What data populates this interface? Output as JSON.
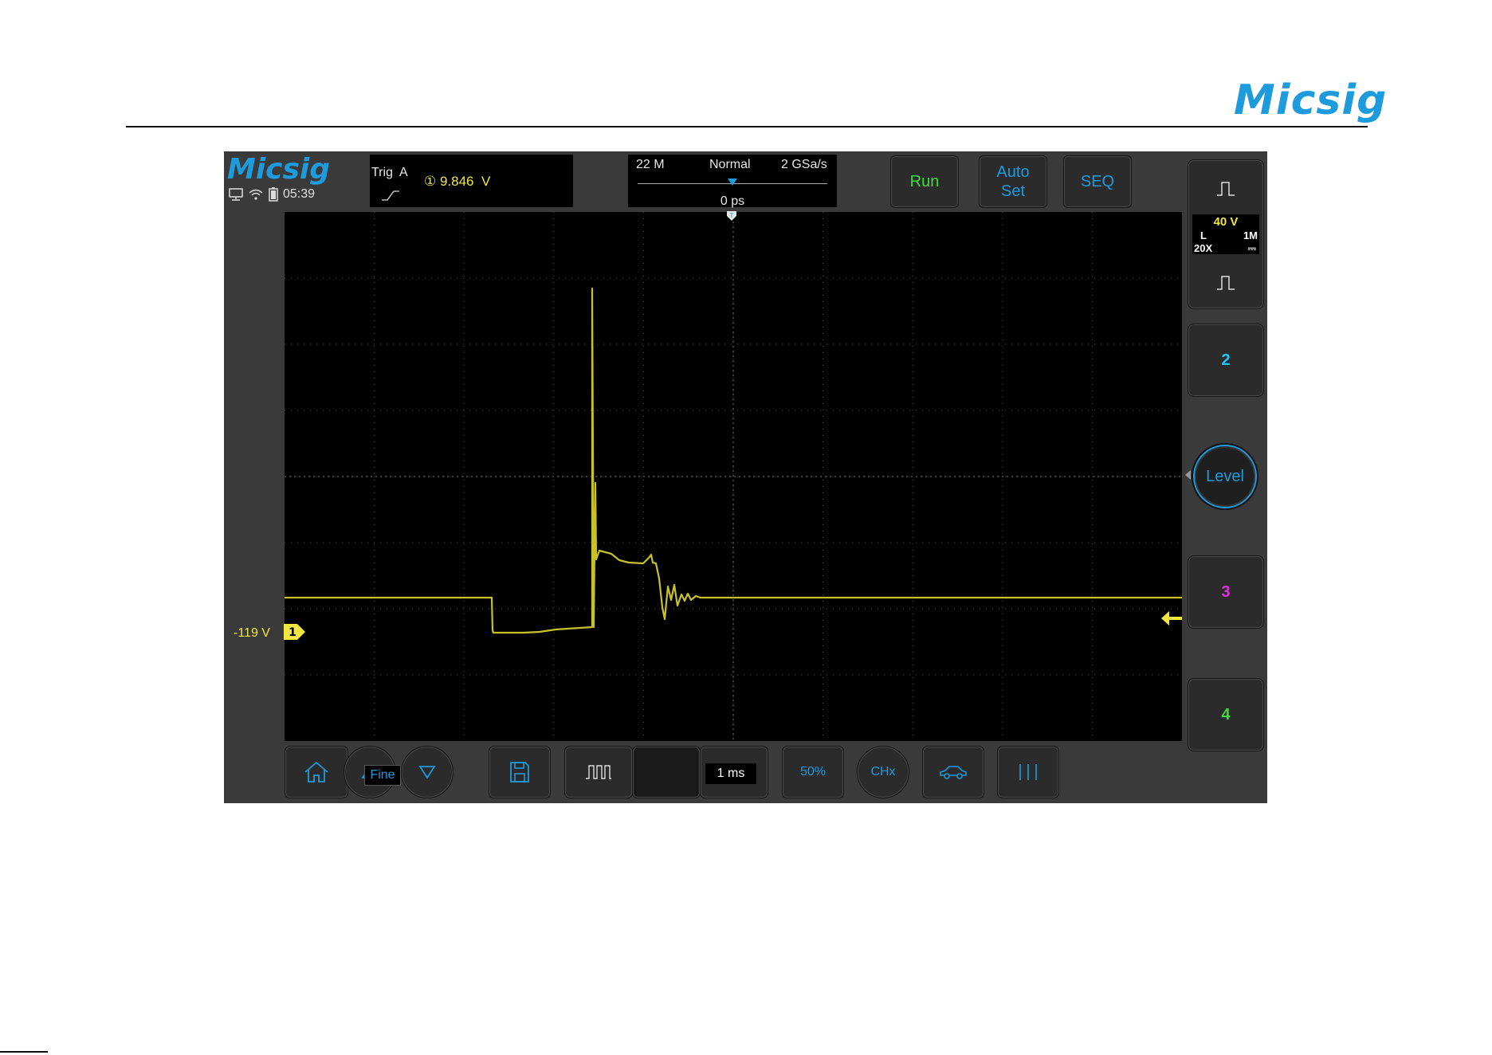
{
  "page": {
    "brand": "Micsig"
  },
  "header": {
    "brand": "Micsig",
    "clock": "05:39",
    "status_icons": [
      "monitor-icon",
      "wifi-icon",
      "battery-icon"
    ]
  },
  "trigger": {
    "label": "Trig  A",
    "value": "① 9.846  V",
    "slope": "rising-edge-icon"
  },
  "acquisition": {
    "memory": "22 M",
    "mode": "Normal",
    "sample_rate": "2 GSa/s",
    "delay": "0 ps"
  },
  "buttons": {
    "run": "Run",
    "autoset_line1": "Auto",
    "autoset_line2": "Set",
    "seq": "SEQ"
  },
  "channel1": {
    "volts": "40 V",
    "coupling": "L",
    "impedance": "1M",
    "probe": "20X",
    "dc": "⎓",
    "offset": "-119 V",
    "marker": "1",
    "color": "#f2e640"
  },
  "channels": {
    "ch2": "2",
    "ch3": "3",
    "ch4": "4",
    "ch2_color": "#1ec8ff",
    "ch3_color": "#e02ee0",
    "ch4_color": "#3ddc3d"
  },
  "level_button": "Level",
  "bottom": {
    "fine": "Fine",
    "timebase": "1 ms",
    "fifty_percent": "50%",
    "chx": "CHx"
  },
  "colors": {
    "accent": "#1e9bdc",
    "run": "#3ddc3d",
    "trace": "#c9c12a"
  }
}
